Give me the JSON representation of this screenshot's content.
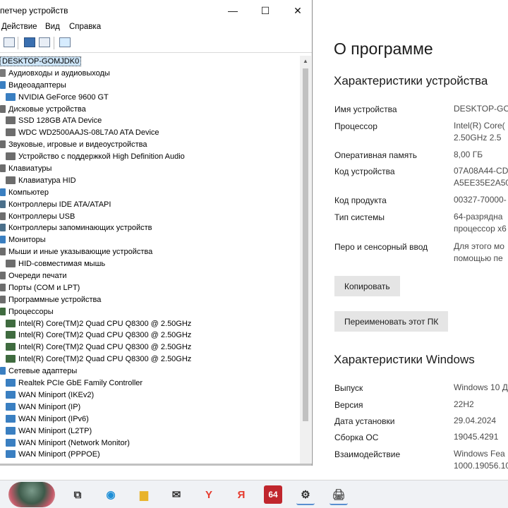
{
  "device_manager": {
    "title": "петчер устройств",
    "window_controls": {
      "minimize": "—",
      "maximize": "☐",
      "close": "✕"
    },
    "menu": [
      "Действие",
      "Вид",
      "Справка"
    ],
    "root": "DESKTOP-GOMJDK0",
    "tree": [
      {
        "level": 0,
        "label": "Аудиовходы и аудиовыходы",
        "icon": "audio-icon",
        "color": "#7a7a7a"
      },
      {
        "level": 0,
        "label": "Видеоадаптеры",
        "icon": "display-adapter-icon",
        "color": "#3a7fc1"
      },
      {
        "level": 1,
        "label": "NVIDIA GeForce 9600 GT",
        "icon": "display-adapter-icon",
        "color": "#3a7fc1"
      },
      {
        "level": 0,
        "label": "Дисковые устройства",
        "icon": "disk-icon",
        "color": "#6d6d6d"
      },
      {
        "level": 1,
        "label": "SSD    128GB ATA Device",
        "icon": "disk-icon",
        "color": "#6d6d6d"
      },
      {
        "level": 1,
        "label": "WDC WD2500AAJS-08L7A0 ATA Device",
        "icon": "disk-icon",
        "color": "#6d6d6d"
      },
      {
        "level": 0,
        "label": "Звуковые, игровые и видеоустройства",
        "icon": "sound-icon",
        "color": "#6d6d6d"
      },
      {
        "level": 1,
        "label": "Устройство с поддержкой High Definition Audio",
        "icon": "sound-icon",
        "color": "#6d6d6d"
      },
      {
        "level": 0,
        "label": "Клавиатуры",
        "icon": "keyboard-icon",
        "color": "#6d6d6d"
      },
      {
        "level": 1,
        "label": "Клавиатура HID",
        "icon": "keyboard-icon",
        "color": "#6d6d6d"
      },
      {
        "level": 0,
        "label": "Компьютер",
        "icon": "computer-icon",
        "color": "#3a7fc1"
      },
      {
        "level": 0,
        "label": "Контроллеры IDE ATA/ATAPI",
        "icon": "controller-icon",
        "color": "#4a6f8a"
      },
      {
        "level": 0,
        "label": "Контроллеры USB",
        "icon": "usb-icon",
        "color": "#6d6d6d"
      },
      {
        "level": 0,
        "label": "Контроллеры запоминающих устройств",
        "icon": "storage-controller-icon",
        "color": "#4a6f8a"
      },
      {
        "level": 0,
        "label": "Мониторы",
        "icon": "monitor-icon",
        "color": "#3a7fc1"
      },
      {
        "level": 0,
        "label": "Мыши и иные указывающие устройства",
        "icon": "mouse-icon",
        "color": "#6d6d6d"
      },
      {
        "level": 1,
        "label": "HID-совместимая мышь",
        "icon": "mouse-icon",
        "color": "#6d6d6d"
      },
      {
        "level": 0,
        "label": "Очереди печати",
        "icon": "printer-icon",
        "color": "#6d6d6d"
      },
      {
        "level": 0,
        "label": "Порты (COM и LPT)",
        "icon": "port-icon",
        "color": "#6d6d6d"
      },
      {
        "level": 0,
        "label": "Программные устройства",
        "icon": "software-device-icon",
        "color": "#6d6d6d"
      },
      {
        "level": 0,
        "label": "Процессоры",
        "icon": "cpu-icon",
        "color": "#3f6b3f"
      },
      {
        "level": 1,
        "label": "Intel(R) Core(TM)2 Quad CPU    Q8300  @ 2.50GHz",
        "icon": "cpu-icon",
        "color": "#3f6b3f"
      },
      {
        "level": 1,
        "label": "Intel(R) Core(TM)2 Quad CPU    Q8300  @ 2.50GHz",
        "icon": "cpu-icon",
        "color": "#3f6b3f"
      },
      {
        "level": 1,
        "label": "Intel(R) Core(TM)2 Quad CPU    Q8300  @ 2.50GHz",
        "icon": "cpu-icon",
        "color": "#3f6b3f"
      },
      {
        "level": 1,
        "label": "Intel(R) Core(TM)2 Quad CPU    Q8300  @ 2.50GHz",
        "icon": "cpu-icon",
        "color": "#3f6b3f"
      },
      {
        "level": 0,
        "label": "Сетевые адаптеры",
        "icon": "network-adapter-icon",
        "color": "#3a7fc1"
      },
      {
        "level": 1,
        "label": "Realtek PCIe GbE Family Controller",
        "icon": "network-adapter-icon",
        "color": "#3a7fc1"
      },
      {
        "level": 1,
        "label": "WAN Miniport (IKEv2)",
        "icon": "network-adapter-icon",
        "color": "#3a7fc1"
      },
      {
        "level": 1,
        "label": "WAN Miniport (IP)",
        "icon": "network-adapter-icon",
        "color": "#3a7fc1"
      },
      {
        "level": 1,
        "label": "WAN Miniport (IPv6)",
        "icon": "network-adapter-icon",
        "color": "#3a7fc1"
      },
      {
        "level": 1,
        "label": "WAN Miniport (L2TP)",
        "icon": "network-adapter-icon",
        "color": "#3a7fc1"
      },
      {
        "level": 1,
        "label": "WAN Miniport (Network Monitor)",
        "icon": "network-adapter-icon",
        "color": "#3a7fc1"
      },
      {
        "level": 1,
        "label": "WAN Miniport (PPPOE)",
        "icon": "network-adapter-icon",
        "color": "#3a7fc1"
      }
    ]
  },
  "about": {
    "title": "О программе",
    "device_section": "Характеристики устройства",
    "device_props": [
      {
        "label": "Имя устройства",
        "value": "DESKTOP-GO"
      },
      {
        "label": "Процессор",
        "value": "Intel(R) Core(",
        "value2": "2.50GHz   2.5"
      },
      {
        "label": "Оперативная память",
        "value": "8,00 ГБ"
      },
      {
        "label": "Код устройства",
        "value": "07A08A44-CD",
        "value2": "A5EE35E2A50"
      },
      {
        "label": "Код продукта",
        "value": "00327-70000-"
      },
      {
        "label": "Тип системы",
        "value": "64-разрядна",
        "value2": "процессор x6"
      },
      {
        "label": "Перо и сенсорный ввод",
        "value": "Для этого мо",
        "value2": "помощью пе"
      }
    ],
    "copy_button": "Копировать",
    "rename_button": "Переименовать этот ПК",
    "windows_section": "Характеристики Windows",
    "windows_props": [
      {
        "label": "Выпуск",
        "value": "Windows 10 Д"
      },
      {
        "label": "Версия",
        "value": "22H2"
      },
      {
        "label": "Дата установки",
        "value": "29.04.2024"
      },
      {
        "label": "Сборка ОС",
        "value": "19045.4291"
      },
      {
        "label": "Взаимодействие",
        "value": "Windows Fea",
        "value2": "1000.19056.10"
      }
    ]
  },
  "taskbar": {
    "items": [
      {
        "name": "task-view-icon",
        "glyph": "⧉",
        "color": "#333333"
      },
      {
        "name": "edge-icon",
        "glyph": "◉",
        "color": "#1f8fd6"
      },
      {
        "name": "file-explorer-icon",
        "glyph": "▆",
        "color": "#e8b32a"
      },
      {
        "name": "mail-icon",
        "glyph": "✉",
        "color": "#333333"
      },
      {
        "name": "yandex-browser-icon",
        "glyph": "Y",
        "color": "#e63b2e"
      },
      {
        "name": "yandex-icon",
        "glyph": "Я",
        "color": "#e63b2e"
      },
      {
        "name": "aida64-icon",
        "glyph": "64",
        "color": "#ffffff"
      },
      {
        "name": "settings-icon",
        "glyph": "⚙",
        "color": "#333333"
      },
      {
        "name": "device-manager-icon",
        "glyph": "🖨",
        "color": "#555555"
      }
    ]
  }
}
